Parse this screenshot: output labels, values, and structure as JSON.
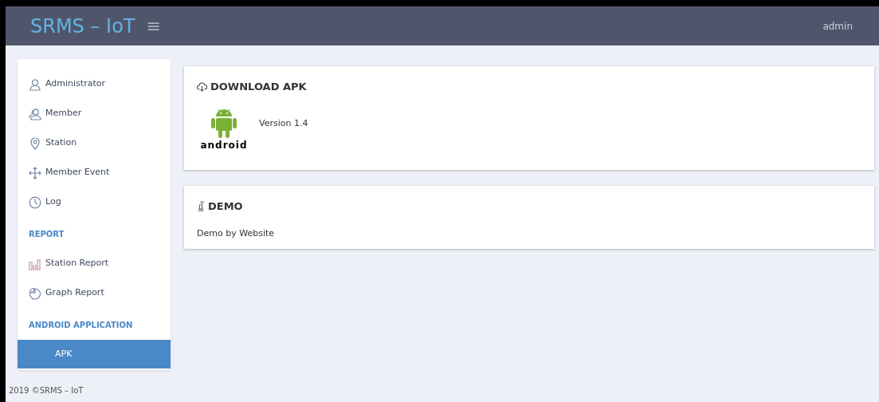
{
  "header": {
    "brand": "SRMS – IoT",
    "menu_glyph": "≡",
    "user": "admin"
  },
  "sidebar": {
    "items": [
      {
        "kind": "item",
        "label": "Administrator",
        "selected": false
      },
      {
        "kind": "item",
        "label": "Member",
        "selected": false
      },
      {
        "kind": "item",
        "label": "Station",
        "selected": false
      },
      {
        "kind": "item",
        "label": "Member Event",
        "selected": false
      },
      {
        "kind": "item",
        "label": "Log",
        "selected": false
      },
      {
        "kind": "header",
        "label": "REPORT"
      },
      {
        "kind": "item",
        "label": "Station Report",
        "selected": false
      },
      {
        "kind": "item",
        "label": "Graph Report",
        "selected": false
      },
      {
        "kind": "header",
        "label": "ANDROID APPLICATION"
      },
      {
        "kind": "item",
        "label": "APK",
        "selected": true
      }
    ]
  },
  "footer": "2019 ©SRMS – IoT",
  "cards": [
    {
      "kind": "download",
      "title": "DOWNLOAD APK",
      "logo_text": "android",
      "version": "Version 1.4"
    },
    {
      "kind": "demo",
      "title": "DEMO",
      "text": "Demo by Website"
    }
  ]
}
